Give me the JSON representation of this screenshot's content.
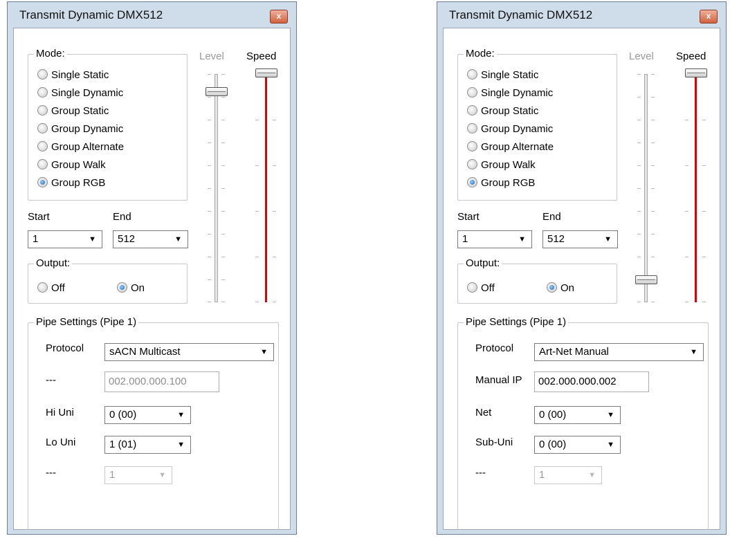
{
  "windows": [
    {
      "title": "Transmit Dynamic DMX512",
      "close_glyph": "x",
      "mode": {
        "legend": "Mode:",
        "options": [
          "Single Static",
          "Single Dynamic",
          "Group Static",
          "Group Dynamic",
          "Group Alternate",
          "Group Walk",
          "Group RGB"
        ],
        "selected": "Group RGB"
      },
      "level": {
        "label": "Level",
        "value_fraction": 0.9
      },
      "speed": {
        "label": "Speed",
        "value_fraction": 1.0
      },
      "start": {
        "label": "Start",
        "value": "1"
      },
      "end": {
        "label": "End",
        "value": "512"
      },
      "output": {
        "legend": "Output:",
        "off_label": "Off",
        "on_label": "On",
        "selected": "On"
      },
      "pipe": {
        "legend": "Pipe Settings (Pipe 1)",
        "protocol_label": "Protocol",
        "protocol_value": "sACN Multicast",
        "ip_label": "---",
        "ip_value": "002.000.000.100",
        "ip_enabled": false,
        "field1_label": "Hi Uni",
        "field1_value": "0 (00)",
        "field2_label": "Lo Uni",
        "field2_value": "1 (01)",
        "field3_label": "---",
        "field3_value": "1"
      }
    },
    {
      "title": "Transmit Dynamic DMX512",
      "close_glyph": "x",
      "mode": {
        "legend": "Mode:",
        "options": [
          "Single Static",
          "Single Dynamic",
          "Group Static",
          "Group Dynamic",
          "Group Alternate",
          "Group Walk",
          "Group RGB"
        ],
        "selected": "Group RGB"
      },
      "level": {
        "label": "Level",
        "value_fraction": 0.1
      },
      "speed": {
        "label": "Speed",
        "value_fraction": 1.0
      },
      "start": {
        "label": "Start",
        "value": "1"
      },
      "end": {
        "label": "End",
        "value": "512"
      },
      "output": {
        "legend": "Output:",
        "off_label": "Off",
        "on_label": "On",
        "selected": "On"
      },
      "pipe": {
        "legend": "Pipe Settings (Pipe 1)",
        "protocol_label": "Protocol",
        "protocol_value": "Art-Net Manual",
        "ip_label": "Manual IP",
        "ip_value": "002.000.000.002",
        "ip_enabled": true,
        "field1_label": "Net",
        "field1_value": "0 (00)",
        "field2_label": "Sub-Uni",
        "field2_value": "0 (00)",
        "field3_label": "---",
        "field3_value": "1"
      }
    }
  ]
}
